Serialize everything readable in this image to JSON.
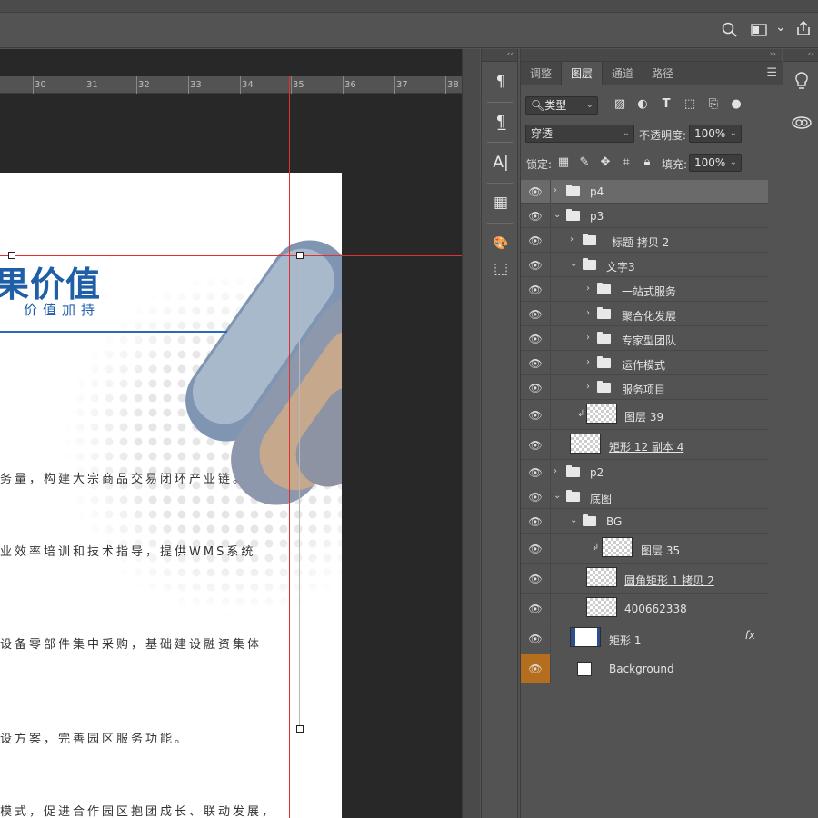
{
  "ruler": {
    "ticks": [
      "30",
      "31",
      "32",
      "33",
      "34",
      "35",
      "36",
      "37",
      "38"
    ]
  },
  "document": {
    "heading": "果价值",
    "subheading": "价值加持",
    "paragraphs": [
      "务量，构建大宗商品交易闭环产业链。",
      "业效率培训和技术指导，提供WMS系统",
      "设备零部件集中采购，基础建设融资集体",
      "设方案，完善园区服务功能。",
      "模式，促进合作园区抱团成长、联动发展，"
    ]
  },
  "toolbar": {
    "icons": [
      "search-icon",
      "workspace-icon",
      "share-icon"
    ],
    "chevron": "⌄"
  },
  "tool_column": {
    "collapse": "‹‹",
    "buttons": [
      "¶",
      "¶̲",
      "A|",
      "▦",
      "🎨",
      "⬚"
    ]
  },
  "layers_panel": {
    "collapse": "››",
    "tabs": [
      "调整",
      "图层",
      "通道",
      "路径"
    ],
    "active_tab": "图层",
    "filter": {
      "label": "类型"
    },
    "blend_mode": "穿透",
    "opacity_label": "不透明度:",
    "opacity_value": "100%",
    "lock_label": "锁定:",
    "fill_label": "填充:",
    "fill_value": "100%",
    "layers": [
      {
        "name": "p4",
        "type": "group",
        "depth": 0,
        "expanded": false,
        "selected": true
      },
      {
        "name": "p3",
        "type": "group",
        "depth": 0,
        "expanded": true
      },
      {
        "name": "标题 拷贝 2",
        "type": "group",
        "depth": 1,
        "expanded": false
      },
      {
        "name": "文字3",
        "type": "group",
        "depth": 1,
        "expanded": true
      },
      {
        "name": "一站式服务",
        "type": "group",
        "depth": 2,
        "expanded": false
      },
      {
        "name": "聚合化发展",
        "type": "group",
        "depth": 2,
        "expanded": false
      },
      {
        "name": "专家型团队",
        "type": "group",
        "depth": 2,
        "expanded": false
      },
      {
        "name": "运作模式",
        "type": "group",
        "depth": 2,
        "expanded": false
      },
      {
        "name": "服务项目",
        "type": "group",
        "depth": 2,
        "expanded": false
      },
      {
        "name": "图层 39",
        "type": "layer",
        "depth": 1,
        "clipped": true
      },
      {
        "name": "矩形 12 副本 4",
        "type": "shape",
        "depth": 1,
        "underline": true
      },
      {
        "name": "p2",
        "type": "group",
        "depth": 0,
        "expanded": false
      },
      {
        "name": "底图",
        "type": "group",
        "depth": 0,
        "expanded": true
      },
      {
        "name": "BG",
        "type": "group",
        "depth": 1,
        "expanded": true
      },
      {
        "name": "图层 35",
        "type": "layer",
        "depth": 2,
        "clipped": true
      },
      {
        "name": "圆角矩形 1 拷贝 2",
        "type": "shape",
        "depth": 2,
        "underline": true
      },
      {
        "name": "400662338",
        "type": "layer",
        "depth": 2
      },
      {
        "name": "矩形 1",
        "type": "shape",
        "depth": 1,
        "fx": "fx"
      },
      {
        "name": "Background",
        "type": "background",
        "depth": 0,
        "highlight": true
      }
    ]
  },
  "right_column": {
    "collapse": "‹‹",
    "buttons": [
      "lightbulb-icon",
      "cloud-icon"
    ]
  },
  "colors": {
    "accent_blue": "#1f5fa8",
    "guide_red": "#e03030",
    "eye_highlight": "#b46e1e"
  }
}
